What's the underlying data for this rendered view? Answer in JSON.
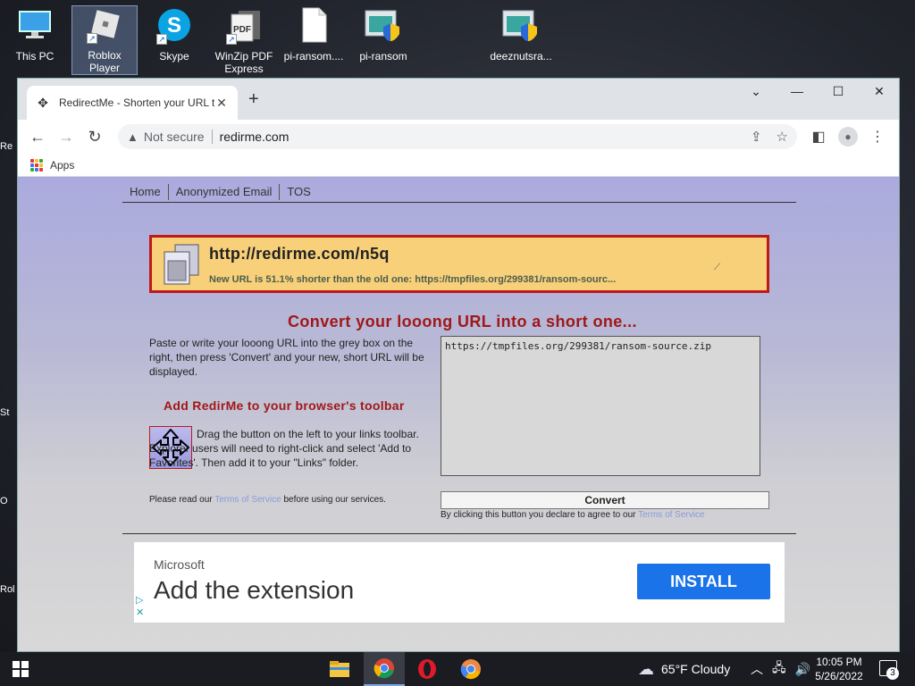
{
  "desktop": {
    "icons": [
      {
        "label": "This PC"
      },
      {
        "label": "Roblox Player"
      },
      {
        "label": "Skype"
      },
      {
        "label": "WinZip PDF Express"
      },
      {
        "label": "pi-ransom...."
      },
      {
        "label": "pi-ransom"
      },
      {
        "label": "deeznutsra..."
      }
    ],
    "edge_labels": [
      "Re",
      "St",
      "O",
      "Rol"
    ]
  },
  "browser": {
    "tab_title": "RedirectMe - Shorten your URL t",
    "security_label": "Not secure",
    "url": "redirme.com",
    "bookmark_apps": "Apps"
  },
  "page": {
    "nav": [
      "Home",
      "Anonymized Email",
      "TOS"
    ],
    "short_url": "http://redirme.com/n5q",
    "short_info": "New URL is 51.1% shorter than the old one: https://tmpfiles.org/299381/ransom-sourc...",
    "headline": "Convert your looong URL into a short one...",
    "intro": "Paste or write your looong URL into the grey box on the right, then press 'Convert' and your new, short URL will be displayed.",
    "toolbar_heading": "Add RedirMe to your browser's toolbar",
    "drag_text": "Drag the button on the left to your links toolbar. Explorer users will need to right-click and select 'Add to Favorites'. Then add it to your \"Links\" folder.",
    "tos_note_before": "Please read our ",
    "tos_link": "Terms of Service",
    "tos_note_after": " before using our services.",
    "input_value": "https://tmpfiles.org/299381/ransom-source.zip",
    "convert_label": "Convert",
    "agree_text": "By clicking this button you declare to agree to our ",
    "agree_link": "Terms of Service"
  },
  "ad": {
    "brand": "Microsoft",
    "headline": "Add the extension",
    "button": "INSTALL"
  },
  "taskbar": {
    "weather": "65°F  Cloudy",
    "time": "10:05 PM",
    "date": "5/26/2022",
    "notifications": "3"
  },
  "colors": {
    "accent_red": "#a01818",
    "result_bg": "#f8d07a",
    "install_blue": "#1a73e8"
  }
}
